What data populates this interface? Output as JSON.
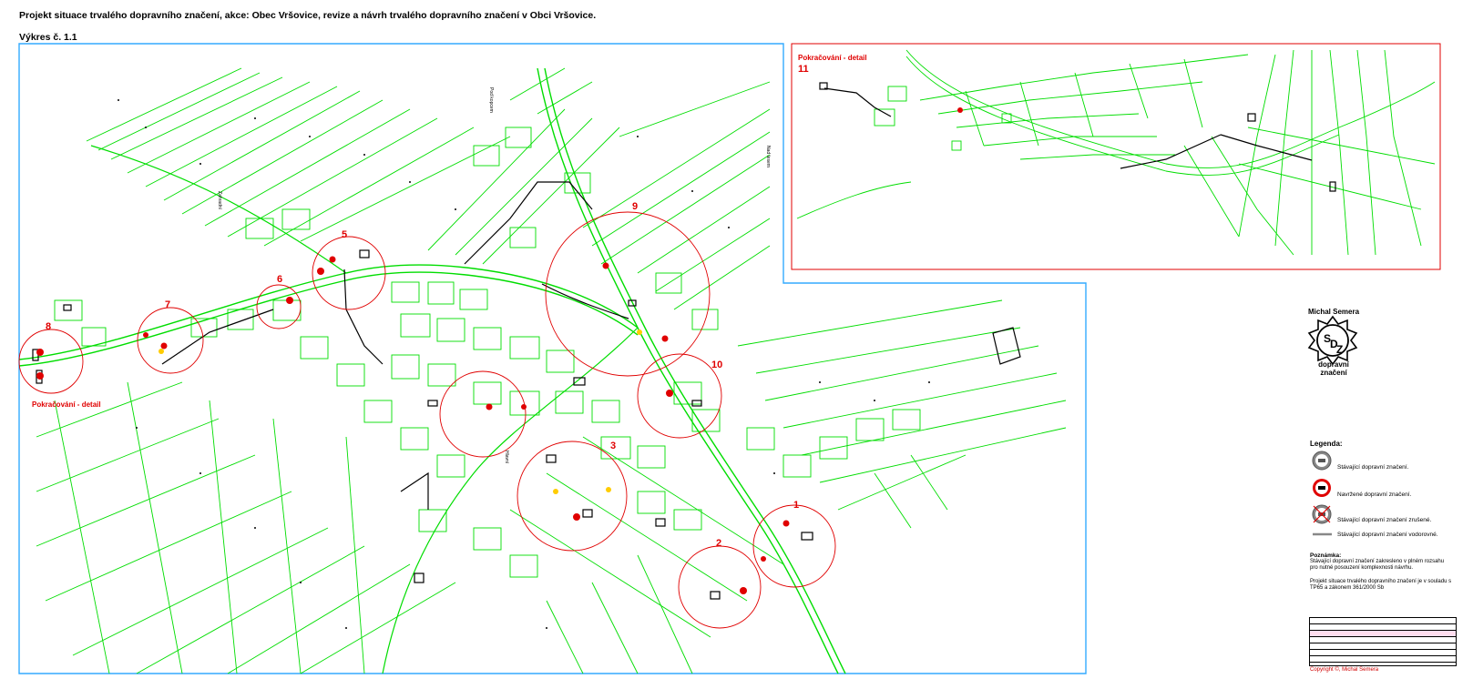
{
  "header": {
    "title": "Projekt situace trvalého dopravního značení, akce: Obec Vršovice, revize a návrh trvalého dopravního značení v Obci Vršovice.",
    "drawing_number": "Výkres č. 1.1"
  },
  "map": {
    "continuation_left": "Pokračování - detail",
    "continuation_detail": "Pokračování - detail",
    "detail_number": "11",
    "street_labels": [
      "Pod kopcem",
      "Zahradní",
      "Nad lesem",
      "Hlavní"
    ],
    "circle_labels": [
      "1",
      "2",
      "3",
      "5",
      "6",
      "7",
      "8",
      "9",
      "10"
    ],
    "colors": {
      "parcels": "#00dd00",
      "circles": "#e00000",
      "main_frame": "#33aaff",
      "detail_frame": "#e00000"
    }
  },
  "logo": {
    "name": "Michal Semera",
    "monogram": "SDZ",
    "subtitle": "dopravní značení"
  },
  "legend": {
    "title": "Legenda:",
    "items": [
      {
        "label": "Stávající dopravní značení.",
        "icon": "existing-sign-icon"
      },
      {
        "label": "Navržené dopravní značení.",
        "icon": "proposed-sign-icon"
      },
      {
        "label": "Stávající dopravní značení zrušené.",
        "icon": "cancelled-sign-icon"
      },
      {
        "label": "Stávající dopravní značení vodorovné.",
        "icon": "horizontal-marking-icon"
      }
    ]
  },
  "note": {
    "title": "Poznámka:",
    "text": "Stávající dopravní značení zakresleno v plném rozsahu pro nutné posouzení komplexnosti návrhu.",
    "text2": "Projekt situace trvalého dopravního značení je v souladu s TP65 a zákonem 361/2000 Sb"
  },
  "copyright": "Copyright ©, Michal Semera"
}
